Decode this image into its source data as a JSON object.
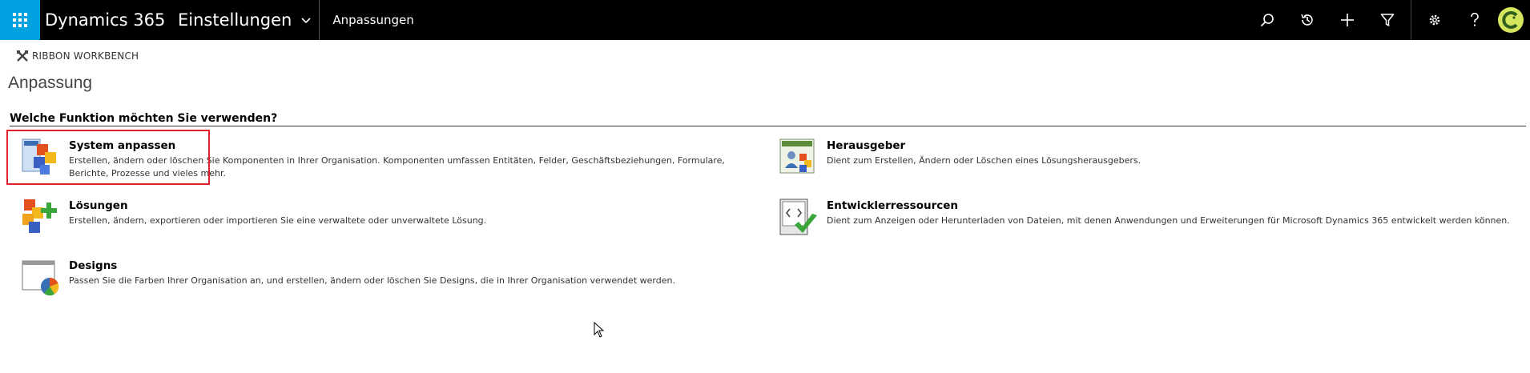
{
  "topbar": {
    "brand": "Dynamics 365",
    "area": "Einstellungen",
    "breadcrumb": "Anpassungen",
    "colors": {
      "bar": "#000000",
      "waffle": "#00a1e0"
    }
  },
  "commandbar": {
    "ribbon_workbench_label": "RIBBON WORKBENCH"
  },
  "page": {
    "title": "Anpassung",
    "question": "Welche Funktion möchten Sie verwenden?"
  },
  "items": [
    {
      "title": "System anpassen",
      "description": "Erstellen, ändern oder löschen Sie Komponenten in Ihrer Organisation. Komponenten umfassen Entitäten, Felder, Geschäftsbeziehungen, Formulare, Berichte, Prozesse und vieles mehr.",
      "icon": "customize-system-icon"
    },
    {
      "title": "Herausgeber",
      "description": "Dient zum Erstellen, Ändern oder Löschen eines Lösungsherausgebers.",
      "icon": "publisher-icon"
    },
    {
      "title": "Lösungen",
      "description": "Erstellen, ändern, exportieren oder importieren Sie eine verwaltete oder unverwaltete Lösung.",
      "icon": "solutions-icon"
    },
    {
      "title": "Entwicklerressourcen",
      "description": "Dient zum Anzeigen oder Herunterladen von Dateien, mit denen Anwendungen und Erweiterungen für Microsoft Dynamics 365 entwickelt werden können.",
      "icon": "developer-resources-icon"
    },
    {
      "title": "Designs",
      "description": "Passen Sie die Farben Ihrer Organisation an, und erstellen, ändern oder löschen Sie Designs, die in Ihrer Organisation verwendet werden.",
      "icon": "themes-icon"
    }
  ],
  "highlight_color": "#e0202a"
}
